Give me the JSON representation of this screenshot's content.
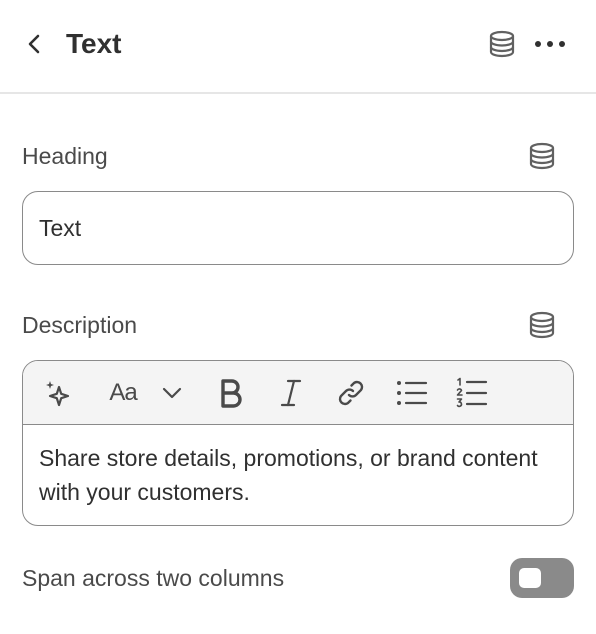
{
  "header": {
    "title": "Text",
    "back_icon": "chevron-left-icon",
    "dynamic_source_icon": "database-icon",
    "more_icon": "ellipsis-horizontal-icon"
  },
  "heading_field": {
    "label": "Heading",
    "value": "Text",
    "dynamic_source_icon": "database-icon"
  },
  "description_field": {
    "label": "Description",
    "dynamic_source_icon": "database-icon",
    "toolbar": {
      "ai_icon": "sparkle-icon",
      "text_style_label": "Aa",
      "text_style_dropdown_icon": "chevron-down-icon",
      "bold_icon": "bold-icon",
      "italic_icon": "italic-icon",
      "link_icon": "link-icon",
      "bullet_list_icon": "bulleted-list-icon",
      "numbered_list_icon": "numbered-list-icon"
    },
    "value": "Share store details, promotions, or brand content with your customers."
  },
  "span_toggle": {
    "label": "Span across two columns",
    "checked": false,
    "off_color": "#8a8a8a"
  }
}
